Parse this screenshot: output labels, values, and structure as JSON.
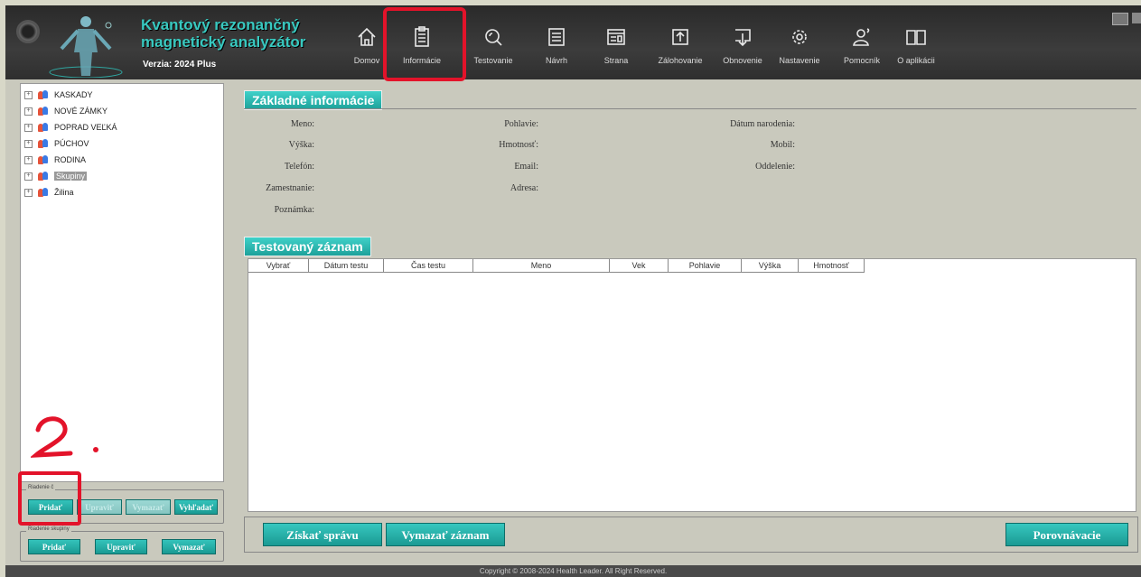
{
  "app": {
    "title_line1": "Kvantový rezonančný",
    "title_line2": "magnetický analyzátor",
    "version": "Verzia: 2024 Plus"
  },
  "nav": [
    {
      "label": "Domov",
      "icon": "home-icon"
    },
    {
      "label": "Informácie",
      "icon": "clipboard-icon"
    },
    {
      "label": "Testovanie",
      "icon": "magnifier-icon"
    },
    {
      "label": "Návrh",
      "icon": "list-icon"
    },
    {
      "label": "Strana",
      "icon": "page-icon"
    },
    {
      "label": "Zálohovanie",
      "icon": "upload-icon"
    },
    {
      "label": "Obnovenie",
      "icon": "download-icon"
    },
    {
      "label": "Nastavenie",
      "icon": "gear-icon"
    },
    {
      "label": "Pomocník",
      "icon": "user-help-icon"
    },
    {
      "label": "O aplikácii",
      "icon": "book-icon"
    }
  ],
  "tree": [
    {
      "label": "KASKADY"
    },
    {
      "label": "NOVÉ ZÁMKY"
    },
    {
      "label": "POPRAD VEĽKÁ"
    },
    {
      "label": "PÚCHOV"
    },
    {
      "label": "RODINA"
    },
    {
      "label": "Skupiny"
    },
    {
      "label": "Žilina"
    }
  ],
  "member_group": {
    "label": "Riadenie č",
    "buttons": [
      "Pridať",
      "Upraviť",
      "Vymazať",
      "Vyhľadať"
    ]
  },
  "group_group": {
    "label": "Riadenie skupiny",
    "buttons": [
      "Pridať",
      "Upraviť",
      "Vymazať"
    ]
  },
  "basic_info": {
    "title": "Základné informácie",
    "fields": {
      "name": "Meno:",
      "gender": "Pohlavie:",
      "birth": "Dátum narodenia:",
      "height": "Výška:",
      "weight": "Hmotnosť:",
      "mobile": "Mobil:",
      "phone": "Telefón:",
      "email": "Email:",
      "department": "Oddelenie:",
      "job": "Zamestnanie:",
      "address": "Adresa:",
      "note": "Poznámka:"
    }
  },
  "records": {
    "title": "Testovaný záznam",
    "columns": [
      "Vybrať",
      "Dátum testu",
      "Čas testu",
      "Meno",
      "Vek",
      "Pohlavie",
      "Výška",
      "Hmotnosť"
    ]
  },
  "actions": {
    "get_report": "Získať správu",
    "delete_record": "Vymazať záznam",
    "compare": "Porovnávacie"
  },
  "footer": "Copyright © 2008-2024 Health Leader. All Right Reserved.",
  "annotation": {
    "step": "2."
  },
  "colors": {
    "accent": "#1fa39c",
    "annotation": "#e3132a",
    "header": "#333333"
  }
}
